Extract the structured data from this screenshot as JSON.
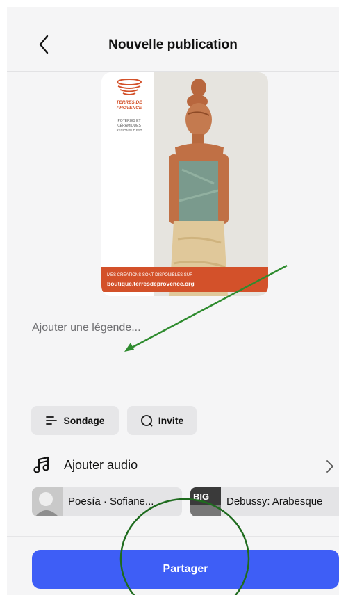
{
  "header": {
    "title": "Nouvelle publication"
  },
  "media": {
    "brand_line1": "TERRES DE",
    "brand_line2": "PROVENCE",
    "tag_line1": "POTERIES ET",
    "tag_line2": "CÉRAMIQUES",
    "tag_line3": "RÉGION SUD EST",
    "banner_line1": "MES CRÉATIONS SONT DISPONIBLES SUR",
    "banner_line2": "boutique.terresdeprovence.org"
  },
  "caption": {
    "placeholder": "Ajouter une légende..."
  },
  "actions": {
    "sondage_label": "Sondage",
    "invite_label": "Invite"
  },
  "audio": {
    "label": "Ajouter audio",
    "suggestions": [
      {
        "label": "Poesía · Sofiane..."
      },
      {
        "label": "Debussy: Arabesque"
      }
    ],
    "thumb2_text": "BIG"
  },
  "footer": {
    "share_label": "Partager"
  },
  "colors": {
    "accent": "#3e5ef6",
    "annotation": "#2e8b2e",
    "brand": "#d3512a",
    "background": "#f5f5f6"
  }
}
